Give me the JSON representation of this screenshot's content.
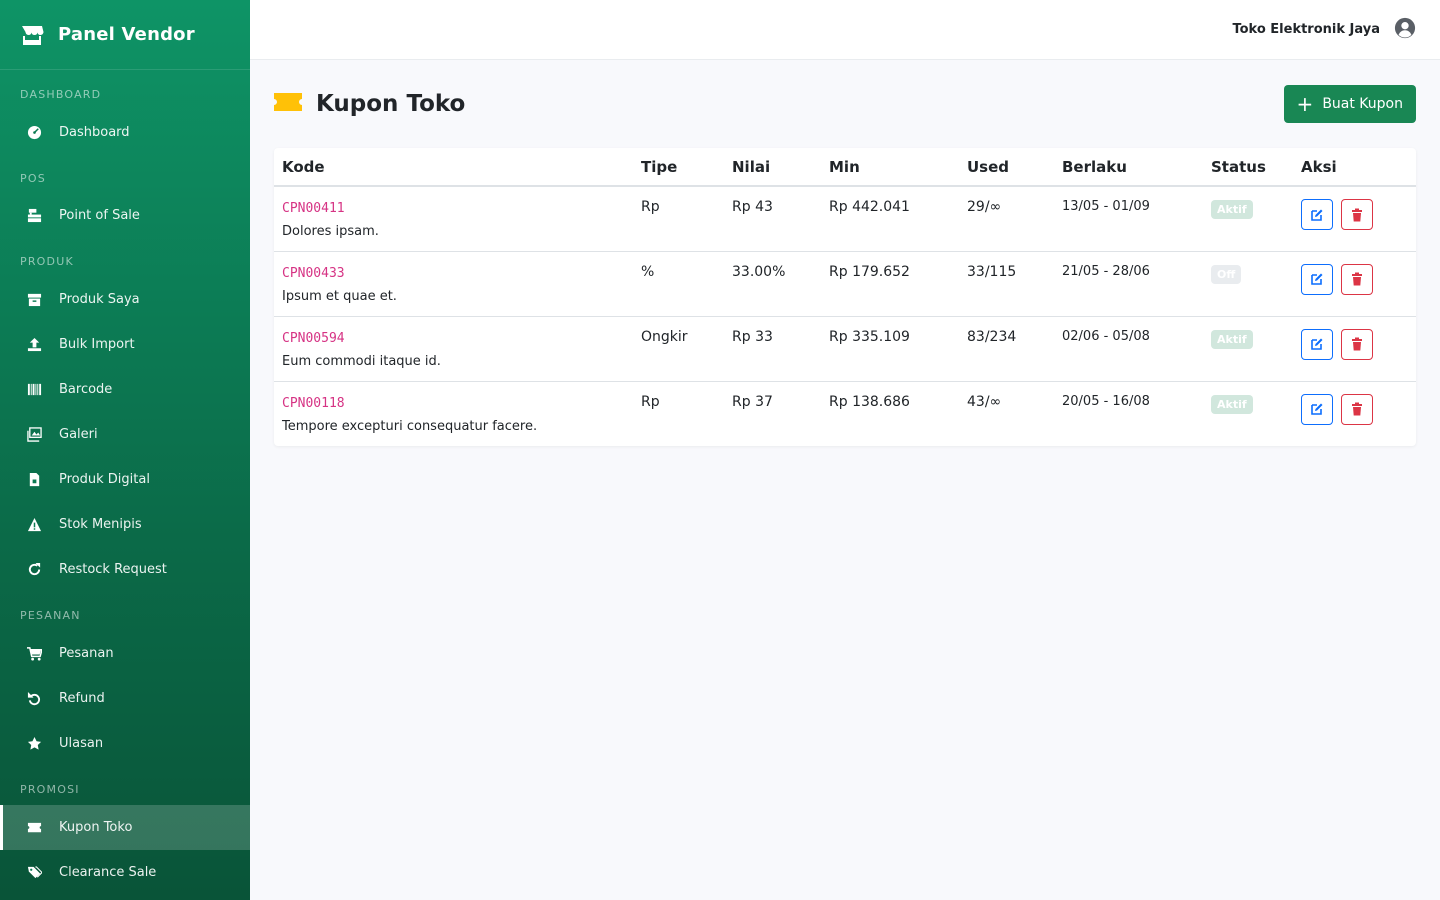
{
  "brand": {
    "title": "Panel Vendor"
  },
  "sidebar": {
    "sections": [
      {
        "label": "DASHBOARD",
        "items": [
          {
            "label": "Dashboard",
            "icon": "dashboard-icon"
          }
        ]
      },
      {
        "label": "POS",
        "items": [
          {
            "label": "Point of Sale",
            "icon": "cash-register-icon"
          }
        ]
      },
      {
        "label": "PRODUK",
        "items": [
          {
            "label": "Produk Saya",
            "icon": "box-icon"
          },
          {
            "label": "Bulk Import",
            "icon": "upload-icon"
          },
          {
            "label": "Barcode",
            "icon": "barcode-icon"
          },
          {
            "label": "Galeri",
            "icon": "images-icon"
          },
          {
            "label": "Produk Digital",
            "icon": "file-icon"
          },
          {
            "label": "Stok Menipis",
            "icon": "warning-icon"
          },
          {
            "label": "Restock Request",
            "icon": "refresh-icon"
          }
        ]
      },
      {
        "label": "PESANAN",
        "items": [
          {
            "label": "Pesanan",
            "icon": "cart-icon"
          },
          {
            "label": "Refund",
            "icon": "undo-icon"
          },
          {
            "label": "Ulasan",
            "icon": "star-icon"
          }
        ]
      },
      {
        "label": "PROMOSI",
        "items": [
          {
            "label": "Kupon Toko",
            "icon": "ticket-icon",
            "active": true
          },
          {
            "label": "Clearance Sale",
            "icon": "tags-icon"
          }
        ]
      }
    ]
  },
  "topbar": {
    "store_name": "Toko Elektronik Jaya",
    "icon": "user-circle-icon"
  },
  "page": {
    "title": "Kupon Toko",
    "icon": "ticket-icon",
    "create_button": "Buat Kupon"
  },
  "table": {
    "headers": [
      "Kode",
      "Tipe",
      "Nilai",
      "Min",
      "Used",
      "Berlaku",
      "Status",
      "Aksi"
    ],
    "rows": [
      {
        "code": "CPN00411",
        "desc": "Dolores ipsam.",
        "type": "Rp",
        "value": "Rp 43",
        "min": "Rp 442.041",
        "used": "29/∞",
        "period": "13/05 - 01/09",
        "status": "Aktif"
      },
      {
        "code": "CPN00433",
        "desc": "Ipsum et quae et.",
        "type": "%",
        "value": "33.00%",
        "min": "Rp 179.652",
        "used": "33/115",
        "period": "21/05 - 28/06",
        "status": "Off"
      },
      {
        "code": "CPN00594",
        "desc": "Eum commodi itaque id.",
        "type": "Ongkir",
        "value": "Rp 33",
        "min": "Rp 335.109",
        "used": "83/234",
        "period": "02/06 - 05/08",
        "status": "Aktif"
      },
      {
        "code": "CPN00118",
        "desc": "Tempore excepturi consequatur facere.",
        "type": "Rp",
        "value": "Rp 37",
        "min": "Rp 138.686",
        "used": "43/∞",
        "period": "20/05 - 16/08",
        "status": "Aktif"
      }
    ]
  },
  "colors": {
    "sidebar_top": "#0e9466",
    "sidebar_bottom": "#095438",
    "primary_button": "#198754",
    "code_text": "#d63384",
    "edit_border": "#0d6efd",
    "delete_border": "#dc3545",
    "ticket_icon": "#ffc107"
  }
}
